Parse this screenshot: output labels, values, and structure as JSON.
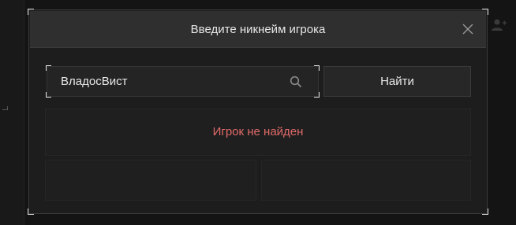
{
  "modal": {
    "title": "Введите никнейм игрока",
    "close_icon": "close-icon"
  },
  "search": {
    "value": "ВладосВист",
    "icon": "search-icon"
  },
  "find_button": {
    "label": "Найти"
  },
  "result": {
    "message": "Игрок не найден",
    "color": "#e26a6a"
  },
  "background": {
    "user_icon": "user-icon"
  }
}
